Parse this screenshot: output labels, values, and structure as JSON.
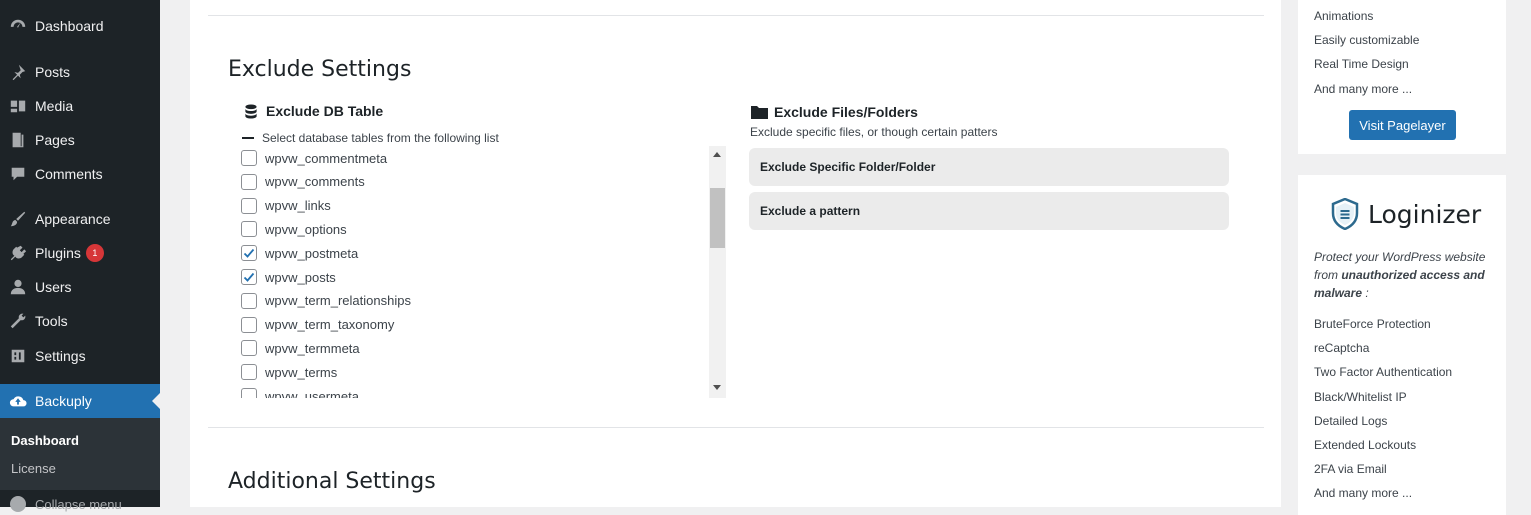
{
  "sidebar": {
    "items": [
      {
        "label": "Dashboard",
        "icon": "dashboard-icon"
      },
      {
        "label": "Posts",
        "icon": "pin-icon"
      },
      {
        "label": "Media",
        "icon": "media-icon"
      },
      {
        "label": "Pages",
        "icon": "page-icon"
      },
      {
        "label": "Comments",
        "icon": "comment-icon"
      },
      {
        "label": "Appearance",
        "icon": "brush-icon"
      },
      {
        "label": "Plugins",
        "icon": "plug-icon",
        "badge": "1"
      },
      {
        "label": "Users",
        "icon": "user-icon"
      },
      {
        "label": "Tools",
        "icon": "wrench-icon"
      },
      {
        "label": "Settings",
        "icon": "settings-icon"
      },
      {
        "label": "Backuply",
        "icon": "cloud-upload-icon"
      }
    ],
    "submenu": [
      "Dashboard",
      "License"
    ],
    "collapse_label": "Collapse menu"
  },
  "exclude": {
    "title": "Exclude Settings",
    "db_heading": "Exclude DB Table",
    "db_subtitle": "Select database tables from the following list",
    "tables": [
      {
        "name": "wpvw_commentmeta",
        "checked": false
      },
      {
        "name": "wpvw_comments",
        "checked": false
      },
      {
        "name": "wpvw_links",
        "checked": false
      },
      {
        "name": "wpvw_options",
        "checked": false
      },
      {
        "name": "wpvw_postmeta",
        "checked": true
      },
      {
        "name": "wpvw_posts",
        "checked": true
      },
      {
        "name": "wpvw_term_relationships",
        "checked": false
      },
      {
        "name": "wpvw_term_taxonomy",
        "checked": false
      },
      {
        "name": "wpvw_termmeta",
        "checked": false
      },
      {
        "name": "wpvw_terms",
        "checked": false
      },
      {
        "name": "wpvw_usermeta",
        "checked": false
      }
    ],
    "files_heading": "Exclude Files/Folders",
    "files_subtitle": "Exclude specific files, or though certain patters",
    "accordions": [
      "Exclude Specific Folder/Folder",
      "Exclude a pattern"
    ]
  },
  "additional": {
    "title": "Additional Settings"
  },
  "pagelayer": {
    "features": [
      "Animations",
      "Easily customizable",
      "Real Time Design",
      "And many more ..."
    ],
    "button": "Visit Pagelayer"
  },
  "loginizer": {
    "title": "Loginizer",
    "desc_pre": "Protect your WordPress website from ",
    "desc_bold": "unauthorized access and malware",
    "desc_post": " :",
    "features": [
      "BruteForce Protection",
      "reCaptcha",
      "Two Factor Authentication",
      "Black/Whitelist IP",
      "Detailed Logs",
      "Extended Lockouts",
      "2FA via Email",
      "And many more ..."
    ]
  },
  "colors": {
    "accent": "#2271b1",
    "sidebar": "#1d2327",
    "badge": "#d63638"
  }
}
